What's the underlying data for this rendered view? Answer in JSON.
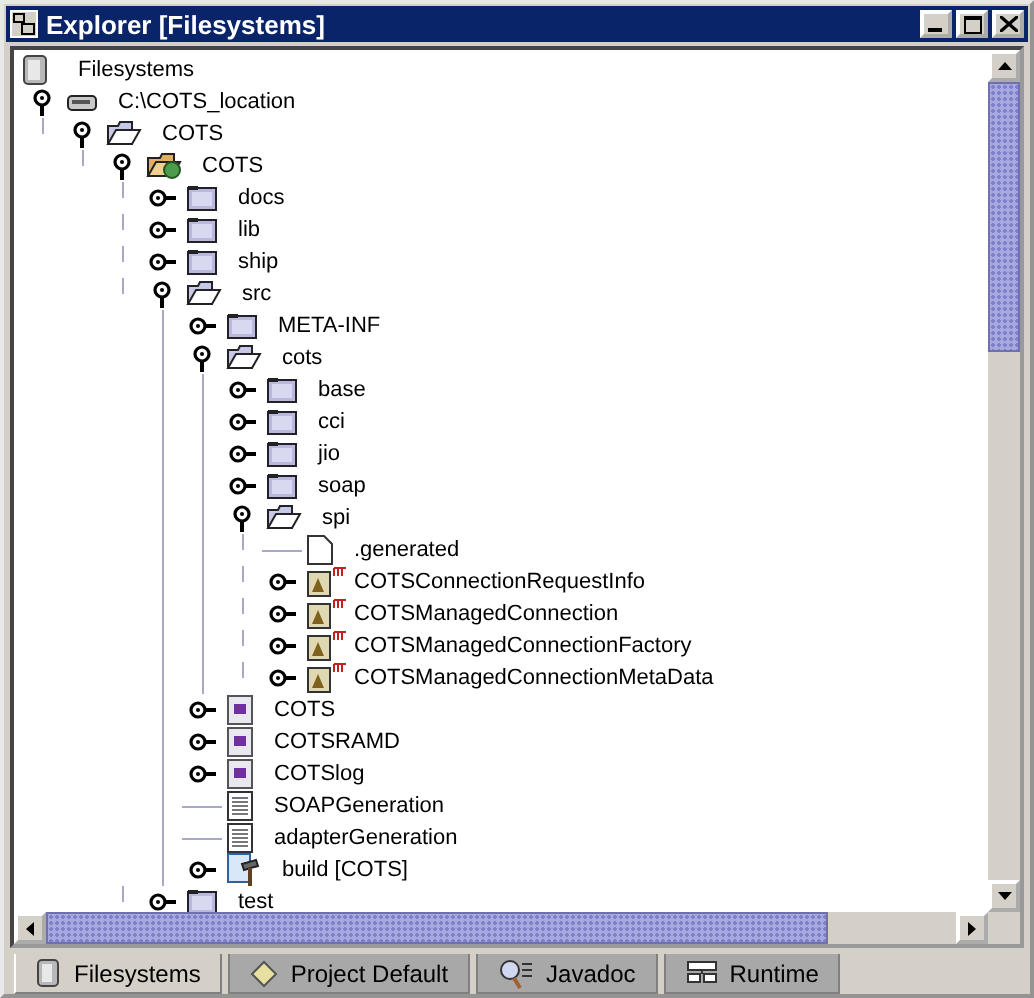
{
  "window": {
    "title": "Explorer [Filesystems]"
  },
  "tree": {
    "root": {
      "label": "Filesystems",
      "kind": "filesystems"
    },
    "children": [
      {
        "label": "C:\\COTS_location",
        "kind": "drive",
        "expanded": true,
        "children": [
          {
            "label": "COTS",
            "kind": "folder",
            "expanded": true,
            "children": [
              {
                "label": "COTS",
                "kind": "package",
                "expanded": true,
                "children": [
                  {
                    "label": "docs",
                    "kind": "folder",
                    "expanded": false
                  },
                  {
                    "label": "lib",
                    "kind": "folder",
                    "expanded": false
                  },
                  {
                    "label": "ship",
                    "kind": "folder",
                    "expanded": false
                  },
                  {
                    "label": "src",
                    "kind": "folder",
                    "expanded": true,
                    "children": [
                      {
                        "label": "META-INF",
                        "kind": "folder",
                        "expanded": false
                      },
                      {
                        "label": "cots",
                        "kind": "folder",
                        "expanded": true,
                        "children": [
                          {
                            "label": "base",
                            "kind": "folder",
                            "expanded": false
                          },
                          {
                            "label": "cci",
                            "kind": "folder",
                            "expanded": false
                          },
                          {
                            "label": "jio",
                            "kind": "folder",
                            "expanded": false
                          },
                          {
                            "label": "soap",
                            "kind": "folder",
                            "expanded": false
                          },
                          {
                            "label": "spi",
                            "kind": "folder",
                            "expanded": true,
                            "children": [
                              {
                                "label": ".generated",
                                "kind": "file"
                              },
                              {
                                "label": "COTSConnectionRequestInfo",
                                "kind": "interface",
                                "expanded": false
                              },
                              {
                                "label": "COTSManagedConnection",
                                "kind": "interface",
                                "expanded": false
                              },
                              {
                                "label": "COTSManagedConnectionFactory",
                                "kind": "interface",
                                "expanded": false
                              },
                              {
                                "label": "COTSManagedConnectionMetaData",
                                "kind": "interface",
                                "expanded": false
                              }
                            ]
                          }
                        ]
                      },
                      {
                        "label": "COTS",
                        "kind": "form",
                        "expanded": false
                      },
                      {
                        "label": "COTSRAMD",
                        "kind": "form",
                        "expanded": false
                      },
                      {
                        "label": "COTSlog",
                        "kind": "form",
                        "expanded": false
                      },
                      {
                        "label": "SOAPGeneration",
                        "kind": "text"
                      },
                      {
                        "label": "adapterGeneration",
                        "kind": "text"
                      },
                      {
                        "label": "build [COTS]",
                        "kind": "build",
                        "expanded": false
                      }
                    ]
                  },
                  {
                    "label": "test",
                    "kind": "folder",
                    "expanded": false
                  }
                ]
              }
            ]
          }
        ]
      }
    ]
  },
  "tabs": [
    {
      "label": "Filesystems",
      "kind": "filesystems",
      "selected": true
    },
    {
      "label": "Project Default",
      "kind": "project",
      "selected": false
    },
    {
      "label": "Javadoc",
      "kind": "javadoc",
      "selected": false
    },
    {
      "label": "Runtime",
      "kind": "runtime",
      "selected": false
    }
  ]
}
